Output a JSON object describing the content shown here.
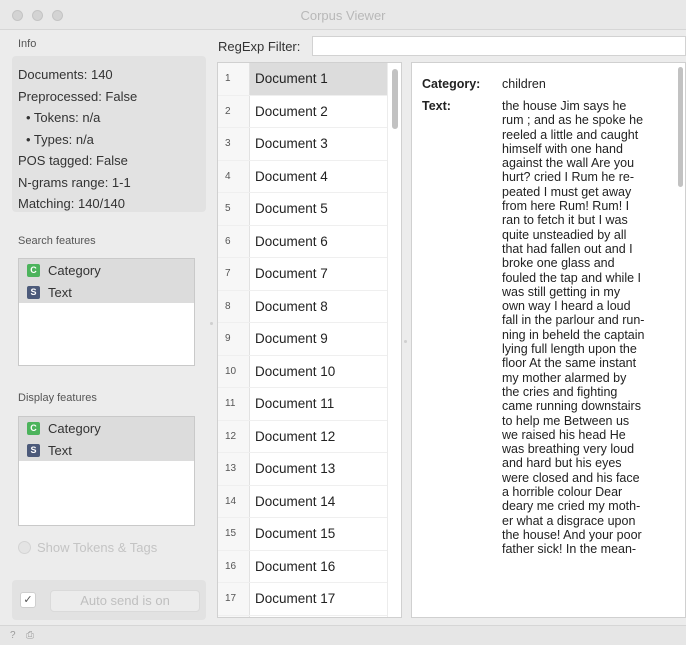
{
  "window": {
    "title": "Corpus Viewer"
  },
  "info": {
    "label": "Info",
    "documents": "Documents: 140",
    "preprocessed": "Preprocessed: False",
    "tokens": "• Tokens: n/a",
    "types": "• Types: n/a",
    "pos_tagged": "POS tagged: False",
    "ngrams": "N-grams range: 1-1",
    "matching": "Matching: 140/140"
  },
  "search_features": {
    "label": "Search features",
    "items": [
      {
        "badge": "C",
        "label": "Category"
      },
      {
        "badge": "S",
        "label": "Text"
      }
    ]
  },
  "display_features": {
    "label": "Display features",
    "items": [
      {
        "badge": "C",
        "label": "Category"
      },
      {
        "badge": "S",
        "label": "Text"
      }
    ]
  },
  "show_tokens": {
    "label": "Show Tokens & Tags"
  },
  "autosend": {
    "check": "✓",
    "label": "Auto send is on"
  },
  "filter": {
    "label": "RegExp Filter:",
    "value": ""
  },
  "documents": [
    {
      "num": "1",
      "name": "Document 1"
    },
    {
      "num": "2",
      "name": "Document 2"
    },
    {
      "num": "3",
      "name": "Document 3"
    },
    {
      "num": "4",
      "name": "Document 4"
    },
    {
      "num": "5",
      "name": "Document 5"
    },
    {
      "num": "6",
      "name": "Document 6"
    },
    {
      "num": "7",
      "name": "Document 7"
    },
    {
      "num": "8",
      "name": "Document 8"
    },
    {
      "num": "9",
      "name": "Document 9"
    },
    {
      "num": "10",
      "name": "Document 10"
    },
    {
      "num": "11",
      "name": "Document 11"
    },
    {
      "num": "12",
      "name": "Document 12"
    },
    {
      "num": "13",
      "name": "Document 13"
    },
    {
      "num": "14",
      "name": "Document 14"
    },
    {
      "num": "15",
      "name": "Document 15"
    },
    {
      "num": "16",
      "name": "Document 16"
    },
    {
      "num": "17",
      "name": "Document 17"
    }
  ],
  "detail": {
    "category_label": "Category:",
    "category_value": "children",
    "text_label": "Text:",
    "text_lines": [
      "the house Jim says he",
      "rum ; and as he spoke he",
      "reeled a little and caught",
      "himself with one hand",
      "against the wall Are you",
      "hurt? cried I Rum he re-",
      "peated I must get away",
      "from here Rum! Rum! I",
      "ran to fetch it but I was",
      "quite unsteadied by all",
      "that had fallen out and I",
      "broke one glass and",
      "fouled the tap and while I",
      "was still getting in my",
      "own way I heard a loud",
      "fall in the parlour and run-",
      "ning in beheld the captain",
      "lying full length upon the",
      "floor At the same instant",
      "my mother alarmed by",
      "the cries and fighting",
      "came running downstairs",
      "to help me Between us",
      "we raised his head He",
      "was breathing very loud",
      "and hard but his eyes",
      "were closed and his face",
      "a horrible colour Dear",
      "deary me cried my moth-",
      "er what a disgrace upon",
      "the house! And your poor",
      "father sick! In the mean-"
    ]
  },
  "statusbar": {
    "help_icon": "?",
    "report_icon": "⎙"
  }
}
